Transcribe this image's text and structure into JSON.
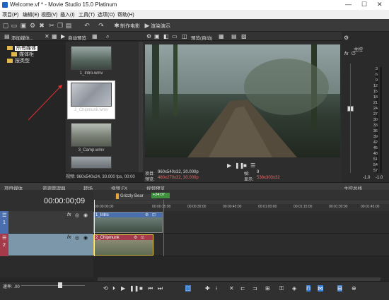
{
  "window": {
    "title": "Welcome.vf * - Movie Studio 15.0 Platinum"
  },
  "menu": [
    "项目(P)",
    "编辑(E)",
    "视图(V)",
    "插入(I)",
    "工具(T)",
    "选项(O)",
    "帮助(H)"
  ],
  "toolbar": {
    "make_movie": "制作电影",
    "render_preview": "渲染演示"
  },
  "media_panel": {
    "add_media_label": "添加媒体...",
    "auto_preview": "自动预览",
    "tree": [
      "所有媒体",
      "媒体柜",
      "按类型"
    ],
    "thumbnails": [
      "1_Intro.wmv",
      "2_Chipmunk.wmv",
      "3_Camp.wmv"
    ],
    "status": "视频: 960x540x24, 30.000 fps, 00:00"
  },
  "preview_panel": {
    "preview_mode": "预览(自动)",
    "project_label": "项目:",
    "project_value": "960x540x32, 30.000p",
    "preview_label": "预览:",
    "preview_value": "480x270x32, 30.000p",
    "frame_label": "帧:",
    "frame_value": "9",
    "display_label": "显示:",
    "display_value": "538x303x32"
  },
  "master_panel": {
    "label": "主控",
    "meter_ticks": [
      "3",
      "6",
      "9",
      "12",
      "15",
      "18",
      "21",
      "24",
      "27",
      "30",
      "33",
      "36",
      "39",
      "42",
      "45",
      "48",
      "51",
      "54",
      "57"
    ],
    "db_left": "-1.0",
    "db_right": "-1.0"
  },
  "tabs_left": [
    "项目媒体",
    "资源管理器",
    "转场",
    "视频 FX"
  ],
  "tabs_mid": [
    "视频预览"
  ],
  "tabs_right": [
    "主控总线"
  ],
  "timeline": {
    "timecode": "00:00:00;09",
    "region_label": "Grizzly Bear",
    "marker": "+24:07",
    "ruler": [
      "00:00:00;00",
      "00:00:15:00",
      "00:00:30:00",
      "00:00:45:00",
      "00:01:00:00",
      "00:01:15:00",
      "00:01:30:00",
      "00:01:45:00"
    ],
    "tracks": [
      {
        "number": "1",
        "events": [
          "1_Intro"
        ]
      },
      {
        "number": "2",
        "events": [
          "2_Chipmunk"
        ]
      }
    ],
    "rate_label": "速率: .00"
  },
  "colors": {
    "accent": "#3a7fd1",
    "video_track": "#4b6fae",
    "audio_track": "#a53a4a",
    "annotation": "#e03030"
  }
}
